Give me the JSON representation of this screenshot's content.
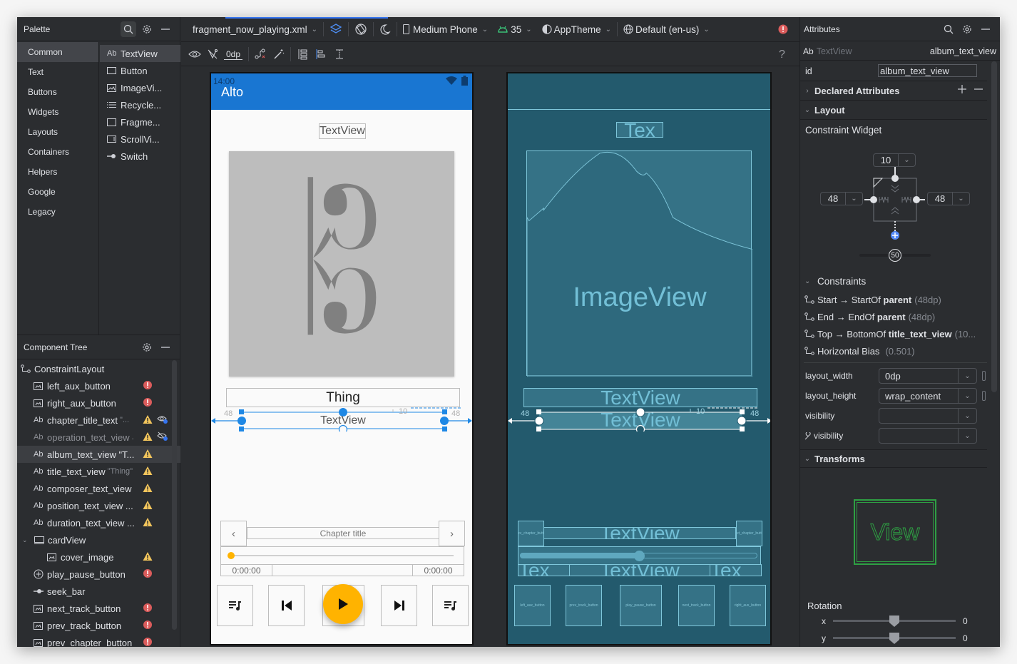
{
  "palette": {
    "title": "Palette",
    "categories": [
      "Common",
      "Text",
      "Buttons",
      "Widgets",
      "Layouts",
      "Containers",
      "Helpers",
      "Google",
      "Legacy"
    ],
    "selected_category": "Common",
    "items": [
      {
        "icon": "textview-icon",
        "label": "TextView",
        "prefix": "Ab"
      },
      {
        "icon": "button-icon",
        "label": "Button"
      },
      {
        "icon": "imageview-icon",
        "label": "ImageVi..."
      },
      {
        "icon": "recyclerview-icon",
        "label": "Recycle..."
      },
      {
        "icon": "fragment-icon",
        "label": "Fragme..."
      },
      {
        "icon": "scrollview-icon",
        "label": "ScrollVi..."
      },
      {
        "icon": "switch-icon",
        "label": "Switch"
      }
    ]
  },
  "component_tree": {
    "title": "Component Tree",
    "rows": [
      {
        "label": "ConstraintLayout",
        "icon": "constraint-layout-icon",
        "indent": 0
      },
      {
        "label": "left_aux_button",
        "icon": "imagebutton-icon",
        "indent": 1,
        "status": "error"
      },
      {
        "label": "right_aux_button",
        "icon": "imagebutton-icon",
        "indent": 1,
        "status": "error"
      },
      {
        "label": "chapter_title_text",
        "prefix": "Ab",
        "hint": "\"...",
        "indent": 1,
        "status": "warning",
        "visibility": "visible-tools"
      },
      {
        "label": "operation_text_view",
        "prefix": "Ab",
        "hint": ".",
        "indent": 1,
        "status": "warning",
        "visibility": "hidden-tools",
        "dim": true
      },
      {
        "label": "album_text_view \"T...",
        "prefix": "Ab",
        "indent": 1,
        "status": "warning",
        "selected": true
      },
      {
        "label": "title_text_view",
        "prefix": "Ab",
        "hint": "\"Thing\"",
        "indent": 1,
        "status": "warning"
      },
      {
        "label": "composer_text_view",
        "prefix": "Ab",
        "indent": 1,
        "status": "warning"
      },
      {
        "label": "position_text_view ...",
        "prefix": "Ab",
        "indent": 1,
        "status": "warning"
      },
      {
        "label": "duration_text_view ...",
        "prefix": "Ab",
        "indent": 1,
        "status": "warning"
      },
      {
        "label": "cardView",
        "icon": "cardview-icon",
        "indent": 1,
        "expanded": true
      },
      {
        "label": "cover_image",
        "icon": "imageview-icon",
        "indent": 2,
        "status": "warning"
      },
      {
        "label": "play_pause_button",
        "icon": "fab-icon",
        "indent": 1,
        "status": "error"
      },
      {
        "label": "seek_bar",
        "icon": "seekbar-icon",
        "indent": 1
      },
      {
        "label": "next_track_button",
        "icon": "imagebutton-icon",
        "indent": 1,
        "status": "error"
      },
      {
        "label": "prev_track_button",
        "icon": "imagebutton-icon",
        "indent": 1,
        "status": "error"
      },
      {
        "label": "prev_chapter_button",
        "icon": "imagebutton-icon",
        "indent": 1,
        "status": "error"
      }
    ]
  },
  "toolbar": {
    "file": "fragment_now_playing.xml",
    "device": "Medium Phone",
    "api": "35",
    "theme": "AppTheme",
    "locale": "Default (en-us)",
    "default_margin": "0dp",
    "help": "?"
  },
  "design": {
    "status_time": "14:00",
    "app_title": "Alto",
    "top_textview": "TextView",
    "title_text": "Thing",
    "album_text": "TextView",
    "margin_start": "48",
    "margin_end": "48",
    "margin_top": "10",
    "chapter_title": "Chapter title",
    "position": "0:00:00",
    "duration": "0:00:00",
    "seek_progress": 0,
    "accent": "#ffb300",
    "appbar_color": "#1976d2"
  },
  "blueprint": {
    "top_text": "Tex",
    "image_label": "ImageView",
    "title_text": "TextView",
    "album_text": "TextView",
    "margin_start": "48",
    "margin_end": "48",
    "margin_top": "10",
    "chapter_text": "TextView",
    "bottom_text": "TextView",
    "side_text": "Tex",
    "prev_chapter_label": "prev_chapter_button",
    "next_chapter_label": "next_chapter_button",
    "seek_progress": 0.5,
    "buttons": [
      "left_aux_button",
      "prev_track_button",
      "play_pause_button",
      "next_track_button",
      "right_aux_button"
    ]
  },
  "attributes": {
    "title": "Attributes",
    "widget_type": "TextView",
    "widget_id": "album_text_view",
    "id_label": "id",
    "id_value": "album_text_view",
    "declared_section": "Declared Attributes",
    "layout_section": "Layout",
    "constraint_widget_label": "Constraint Widget",
    "margin_top": "10",
    "margin_start": "48",
    "margin_end": "48",
    "vertical_bias": "50",
    "constraints_section": "Constraints",
    "constraints": [
      {
        "a": "Start",
        "b": "StartOf",
        "target": "parent",
        "value": "(48dp)"
      },
      {
        "a": "End",
        "b": "EndOf",
        "target": "parent",
        "value": "(48dp)"
      },
      {
        "a": "Top",
        "b": "BottomOf",
        "target": "title_text_view",
        "value": "(10..."
      }
    ],
    "bias_label": "Horizontal Bias",
    "bias_value": "(0.501)",
    "fields": [
      {
        "label": "layout_width",
        "value": "0dp"
      },
      {
        "label": "layout_height",
        "value": "wrap_content"
      },
      {
        "label": "visibility",
        "value": ""
      },
      {
        "label": "visibility",
        "value": "",
        "tools": true
      }
    ],
    "transforms_section": "Transforms",
    "view_preview": "View",
    "rotation_label": "Rotation",
    "rotation_x_label": "x",
    "rotation_x": "0",
    "rotation_y_label": "y",
    "rotation_y": "0"
  }
}
